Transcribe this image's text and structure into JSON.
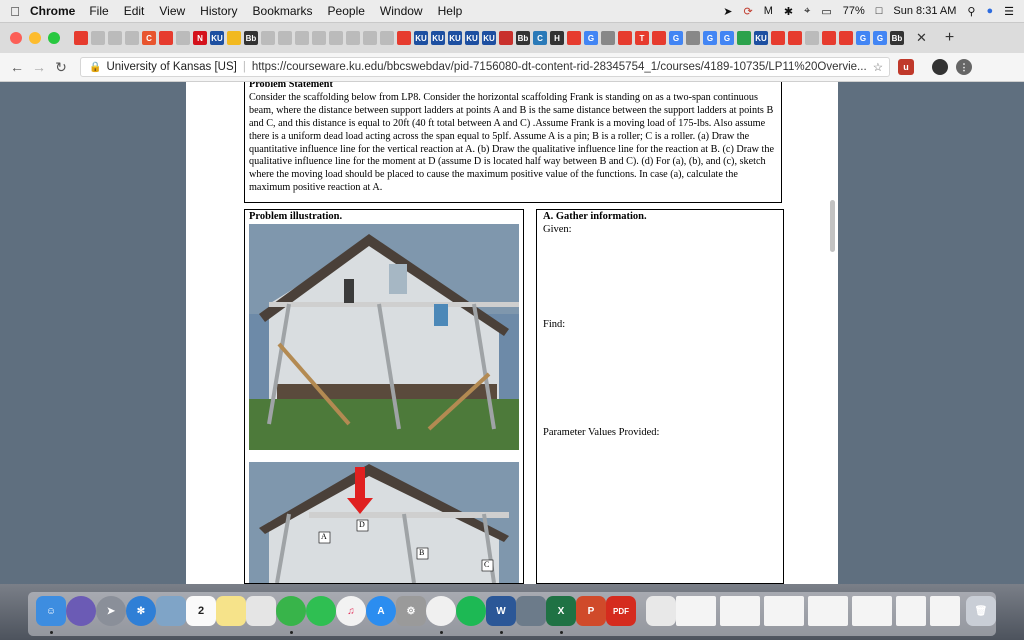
{
  "menubar": {
    "app_name": "Chrome",
    "items": [
      "File",
      "Edit",
      "View",
      "History",
      "Bookmarks",
      "People",
      "Window",
      "Help"
    ],
    "battery": "77%",
    "clock": "Sun 8:31 AM"
  },
  "browser": {
    "tab_icons": [
      {
        "label": "",
        "color": "#e63b2e"
      },
      {
        "label": "",
        "color": "#bbbbbb"
      },
      {
        "label": "",
        "color": "#bbbbbb"
      },
      {
        "label": "",
        "color": "#bbbbbb"
      },
      {
        "label": "C",
        "color": "#e8552e"
      },
      {
        "label": "",
        "color": "#e63b2e"
      },
      {
        "label": "",
        "color": "#bbbbbb"
      },
      {
        "label": "N",
        "color": "#d4111b"
      },
      {
        "label": "KU",
        "color": "#1d4fa1"
      },
      {
        "label": "",
        "color": "#f2b91f"
      },
      {
        "label": "Bb",
        "color": "#333333"
      },
      {
        "label": "",
        "color": "#bbbbbb"
      },
      {
        "label": "",
        "color": "#bbbbbb"
      },
      {
        "label": "",
        "color": "#bbbbbb"
      },
      {
        "label": "",
        "color": "#bbbbbb"
      },
      {
        "label": "",
        "color": "#bbbbbb"
      },
      {
        "label": "",
        "color": "#bbbbbb"
      },
      {
        "label": "",
        "color": "#bbbbbb"
      },
      {
        "label": "",
        "color": "#bbbbbb"
      },
      {
        "label": "",
        "color": "#e63b2e"
      },
      {
        "label": "KU",
        "color": "#1d4fa1"
      },
      {
        "label": "KU",
        "color": "#1d4fa1"
      },
      {
        "label": "KU",
        "color": "#1d4fa1"
      },
      {
        "label": "KU",
        "color": "#1d4fa1"
      },
      {
        "label": "KU",
        "color": "#1d4fa1"
      },
      {
        "label": "",
        "color": "#c9302c"
      },
      {
        "label": "Bb",
        "color": "#333333"
      },
      {
        "label": "C",
        "color": "#2a7ab8"
      },
      {
        "label": "H",
        "color": "#333333"
      },
      {
        "label": "",
        "color": "#e63b2e"
      },
      {
        "label": "G",
        "color": "#4285f4"
      },
      {
        "label": "",
        "color": "#888888"
      },
      {
        "label": "",
        "color": "#e63b2e"
      },
      {
        "label": "T",
        "color": "#e63b2e"
      },
      {
        "label": "",
        "color": "#e63b2e"
      },
      {
        "label": "G",
        "color": "#4285f4"
      },
      {
        "label": "",
        "color": "#888888"
      },
      {
        "label": "G",
        "color": "#4285f4"
      },
      {
        "label": "G",
        "color": "#4285f4"
      },
      {
        "label": "",
        "color": "#2ca24c"
      },
      {
        "label": "KU",
        "color": "#1d4fa1"
      },
      {
        "label": "",
        "color": "#e63b2e"
      },
      {
        "label": "",
        "color": "#e63b2e"
      },
      {
        "label": "",
        "color": "#bbbbbb"
      },
      {
        "label": "",
        "color": "#e63b2e"
      },
      {
        "label": "",
        "color": "#e63b2e"
      },
      {
        "label": "G",
        "color": "#4285f4"
      },
      {
        "label": "G",
        "color": "#4285f4"
      },
      {
        "label": "Bb",
        "color": "#333333"
      }
    ],
    "address_org": "University of Kansas [US]",
    "address_url": "https://courseware.ku.edu/bbcswebdav/pid-7156080-dt-content-rid-28345754_1/courses/4189-10735/LP11%20Overvie..."
  },
  "document": {
    "statement_title": "Problem Statement",
    "statement_text": "Consider the scaffolding below from LP8. Consider the horizontal scaffolding Frank is standing on as a two-span continuous beam, where the distance between support ladders at points A and B is the same distance between the support ladders at points B and C, and this distance is equal to 20ft (40 ft total between A and C) .Assume Frank is a moving load of 175-lbs. Also assume there is a uniform dead load acting across the span equal to 5plf. Assume A is a pin; B is a roller; C is a roller. (a) Draw the quantitative influence line for the vertical reaction at A. (b) Draw the qualitative influence line for the reaction at B. (c) Draw the qualitative influence line for the moment at D (assume D is located half way between B and C). (d) For (a), (b), and (c), sketch where the moving load should be placed to cause the maximum positive value of the functions. In case (a), calculate the maximum positive reaction at A.",
    "illustration_label": "Problem illustration.",
    "gather_title": "A. Gather information.",
    "given_label": "Given:",
    "find_label": "Find:",
    "params_label": "Parameter Values Provided:",
    "photo_markers": [
      "A",
      "D",
      "B",
      "C"
    ]
  },
  "dock": {
    "calendar_day": "2"
  }
}
